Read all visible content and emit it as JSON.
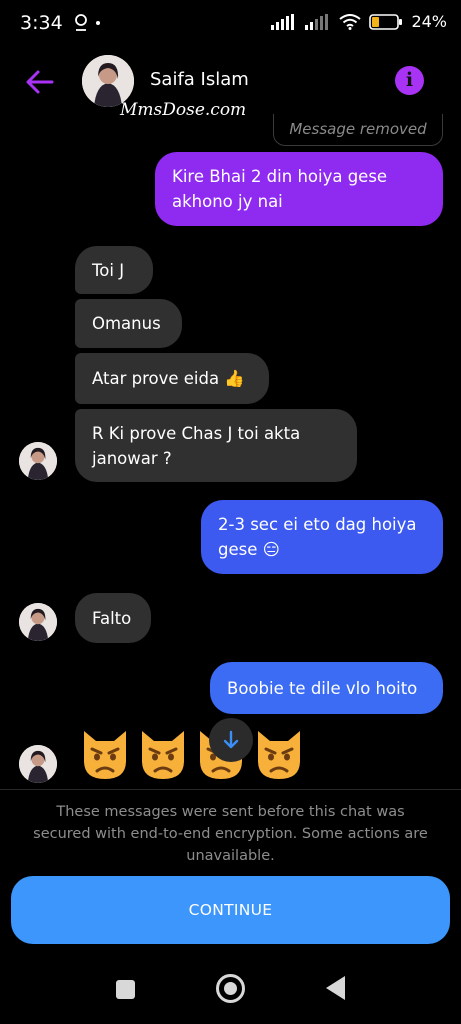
{
  "status_bar": {
    "time": "3:34",
    "battery": "24%"
  },
  "header": {
    "contact_name": "Saifa Islam",
    "info_label": "i"
  },
  "watermark": "MmsDose.com",
  "messages": {
    "removed": "Message removed",
    "m1": "Kire Bhai 2 din hoiya gese akhono jy nai",
    "m2": "Toi J",
    "m3": "Omanus",
    "m4": "Atar prove eida 👍",
    "m5": "R Ki prove Chas J toi akta janowar ?",
    "m6": "2-3 sec ei eto dag hoiya gese 😑",
    "m7": "Falto",
    "m8": "Boobie te dile vlo hoito",
    "m9_emoji": [
      "😾",
      "😾",
      "😾",
      "😾"
    ]
  },
  "notice": "These messages were sent before this chat was secured with end-to-end encryption. Some actions are unavailable.",
  "continue_label": "CONTINUE",
  "colors": {
    "accent_purple": "#a833f5",
    "sent_purple": "#8f2af0",
    "sent_blue": "#3d5af0",
    "incoming": "#303030",
    "continue": "#3c96fb"
  }
}
